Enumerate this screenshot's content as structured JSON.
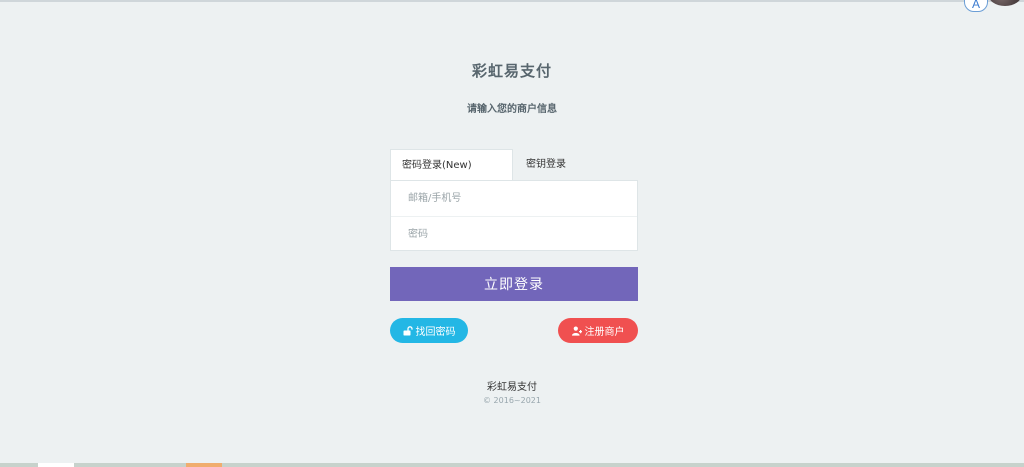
{
  "header": {
    "title": "彩虹易支付",
    "subtitle": "请输入您的商户信息",
    "corner_letter": "A"
  },
  "tabs": [
    {
      "label": "密码登录(New)",
      "active": true
    },
    {
      "label": "密钥登录",
      "active": false
    }
  ],
  "form": {
    "account_placeholder": "邮箱/手机号",
    "password_placeholder": "密码"
  },
  "actions": {
    "login_label": "立即登录",
    "find_password_label": "找回密码",
    "register_label": "注册商户"
  },
  "footer": {
    "name": "彩虹易支付",
    "copyright": "© 2016~2021"
  },
  "colors": {
    "background": "#edf1f2",
    "login_button": "#7266ba",
    "find_button": "#23b7e5",
    "register_button": "#f05050"
  },
  "icons": {
    "find_password": "unlock-icon",
    "register": "user-plus-icon"
  }
}
